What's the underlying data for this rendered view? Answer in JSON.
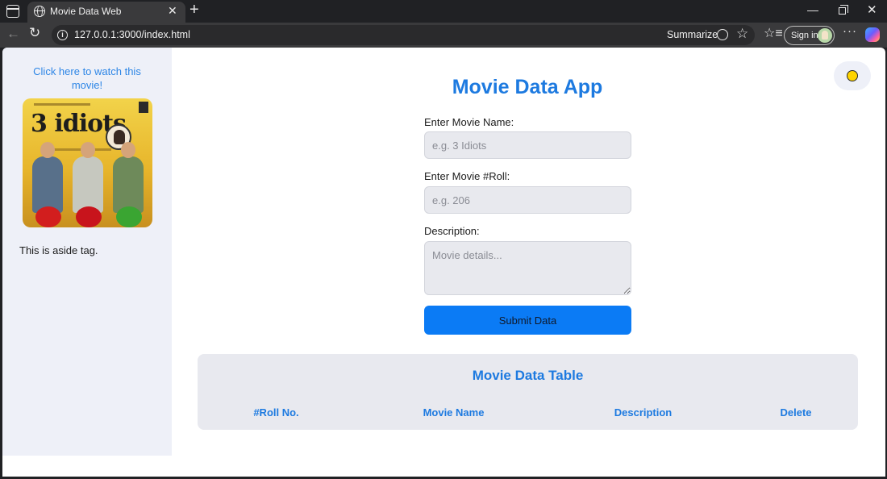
{
  "browser": {
    "tab_title": "Movie Data Web",
    "tab_close": "✕",
    "new_tab": "+",
    "url": "127.0.0.1:3000/index.html",
    "summarize_label": "Summarize",
    "signin_label": "Sign in",
    "more_label": "···",
    "window_min": "—",
    "window_close": "✕",
    "back": "←",
    "reload": "↻",
    "star": "☆",
    "favorites": "☆≡"
  },
  "aside": {
    "watch_link": "Click here to watch this movie!",
    "poster_title": "3 idiots",
    "text": "This is aside tag."
  },
  "main": {
    "title": "Movie Data App",
    "theme_icon": "✹",
    "form": {
      "name_label": "Enter Movie Name:",
      "name_placeholder": "e.g. 3 Idiots",
      "roll_label": "Enter Movie #Roll:",
      "roll_placeholder": "e.g. 206",
      "description_label": "Description:",
      "description_placeholder": "Movie details...",
      "submit_label": "Submit Data"
    },
    "table": {
      "title": "Movie Data Table",
      "headers": [
        "#Roll No.",
        "Movie Name",
        "Description",
        "Delete"
      ]
    }
  },
  "colors": {
    "accent": "#1d7ae0",
    "button": "#0b7bf5",
    "aside_bg": "#eef0f8"
  }
}
